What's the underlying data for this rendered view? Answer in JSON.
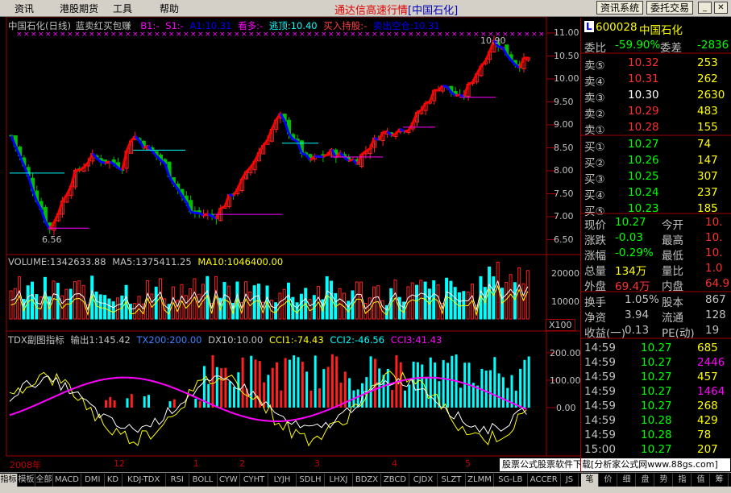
{
  "menu": [
    "资讯",
    "港股期货",
    "工具",
    "帮助"
  ],
  "app_title": "通达信高速行情",
  "app_stock": "[中国石化]",
  "top_buttons": [
    "资讯系统",
    "委托交易"
  ],
  "chart": {
    "header_name": "中国石化(日线)",
    "header_indicator": "蓝卖红买包赚",
    "header_b1": "B1:-",
    "header_s1": "S1:-",
    "header_a1": "A1:10.31",
    "header_kanduo": "看多:-",
    "header_taodun": "逃顶:10.40",
    "header_buy": "买入持股:-",
    "header_sell": "卖出空仓:10.31",
    "price_ticks": [
      "11.00",
      "10.50",
      "10.00",
      "9.50",
      "9.00",
      "8.50",
      "8.00",
      "7.50",
      "7.00",
      "6.50"
    ],
    "high_label": "10.90",
    "low_label": "6.56",
    "vol_header": "VOLUME:1342633.88",
    "vol_ma5": "MA5:1375411.25",
    "vol_ma10": "MA10:1046400.00",
    "vol_ticks": [
      "20000",
      "10000"
    ],
    "vol_unit": "X100",
    "ind_header": "TDX副图指标",
    "ind_out": "输出1:145.42",
    "ind_tx": "TX200:200.00",
    "ind_dx": "DX10:10.00",
    "ind_cci1": "CCI1:-74.43",
    "ind_cci2": "CCI2:-46.56",
    "ind_cci3": "CCI3:41.43",
    "ind_ticks": [
      "200.00",
      "100.00",
      "0.00"
    ],
    "date_labels": [
      "2008年",
      "12",
      "1",
      "2",
      "3",
      "4",
      "5"
    ]
  },
  "quote": {
    "code": "600028",
    "name": "中国石化",
    "webi_label": "委比",
    "webi_value": "-59.90%",
    "wecha_label": "委差",
    "wecha_value": "-2836",
    "sells": [
      {
        "label": "卖⑤",
        "price": "10.32",
        "vol": "253"
      },
      {
        "label": "卖④",
        "price": "10.31",
        "vol": "262"
      },
      {
        "label": "卖③",
        "price": "10.30",
        "vol": "2630"
      },
      {
        "label": "卖②",
        "price": "10.29",
        "vol": "483"
      },
      {
        "label": "卖①",
        "price": "10.28",
        "vol": "155"
      }
    ],
    "buys": [
      {
        "label": "买①",
        "price": "10.27",
        "vol": "74"
      },
      {
        "label": "买②",
        "price": "10.26",
        "vol": "147"
      },
      {
        "label": "买③",
        "price": "10.25",
        "vol": "307"
      },
      {
        "label": "买④",
        "price": "10.24",
        "vol": "237"
      },
      {
        "label": "买⑤",
        "price": "10.23",
        "vol": "185"
      }
    ],
    "stats": [
      {
        "l1": "现价",
        "v1": "10.27",
        "l2": "今开",
        "v2": "10."
      },
      {
        "l1": "涨跌",
        "v1": "-0.03",
        "l2": "最高",
        "v2": "10."
      },
      {
        "l1": "涨幅",
        "v1": "-0.29%",
        "l2": "最低",
        "v2": "10."
      },
      {
        "l1": "总量",
        "v1": "134万",
        "l2": "量比",
        "v2": "1.0"
      },
      {
        "l1": "外盘",
        "v1": "69.4万",
        "l2": "内盘",
        "v2": "64.9"
      }
    ],
    "stats2": [
      {
        "l1": "换手",
        "v1": "1.05%",
        "l2": "股本",
        "v2": "867"
      },
      {
        "l1": "净资",
        "v1": "3.94",
        "l2": "流通",
        "v2": "128"
      },
      {
        "l1": "收益(一)",
        "v1": "0.13",
        "l2": "PE(动)",
        "v2": "19"
      }
    ],
    "ticks": [
      {
        "time": "14:59",
        "price": "10.27",
        "vol": "685"
      },
      {
        "time": "14:59",
        "price": "10.27",
        "vol": "2446"
      },
      {
        "time": "14:59",
        "price": "10.27",
        "vol": "457"
      },
      {
        "time": "14:59",
        "price": "10.27",
        "vol": "1464"
      },
      {
        "time": "14:59",
        "price": "10.27",
        "vol": "268"
      },
      {
        "time": "14:59",
        "price": "10.28",
        "vol": "429"
      },
      {
        "time": "14:59",
        "price": "10.28",
        "vol": "78"
      },
      {
        "time": "15:00",
        "price": "10.27",
        "vol": "207"
      }
    ]
  },
  "bottom_tabs": [
    "指标",
    "模板",
    "全部",
    "MACD",
    "DMI",
    "KD",
    "KDJ-TDX",
    "RSI",
    "BOLL",
    "CYW",
    "CYHT",
    "LYJH",
    "SDLH",
    "LHXJ",
    "BDZX",
    "ZBCD",
    "CJDX",
    "SLZT",
    "ZLMM",
    "SG-LB",
    "ACCER",
    "JS"
  ],
  "right_tabs": [
    "笔",
    "价",
    "细",
    "盘",
    "势",
    "指",
    "值",
    "筹"
  ],
  "ad_text": "股票公式股票软件下载[分析家公式网www.88gs.com]"
}
